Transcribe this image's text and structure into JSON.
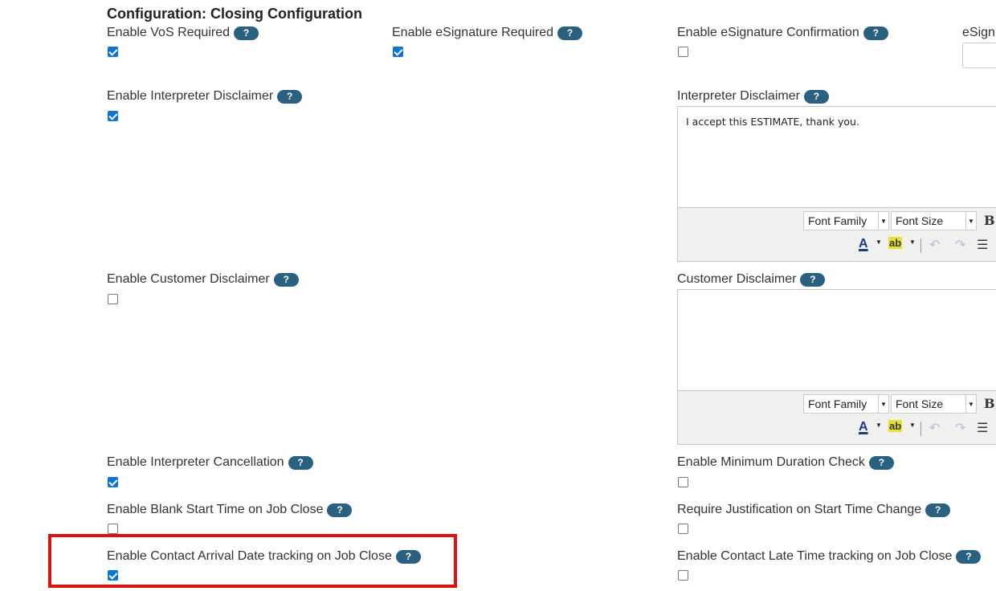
{
  "section_title": "Configuration: Closing Configuration",
  "help_label": "?",
  "fields": {
    "vos_required": {
      "label": "Enable VoS Required",
      "checked": true
    },
    "esignature_required": {
      "label": "Enable eSignature Required",
      "checked": true
    },
    "esignature_confirmation": {
      "label": "Enable eSignature Confirmation",
      "checked": false
    },
    "esign_partial": {
      "label": "eSign"
    },
    "interpreter_disclaimer_enable": {
      "label": "Enable Interpreter Disclaimer",
      "checked": true
    },
    "interpreter_disclaimer": {
      "label": "Interpreter Disclaimer",
      "text": "I accept this ESTIMATE, thank you."
    },
    "customer_disclaimer_enable": {
      "label": "Enable Customer Disclaimer",
      "checked": false
    },
    "customer_disclaimer": {
      "label": "Customer Disclaimer",
      "text": ""
    },
    "interpreter_cancellation": {
      "label": "Enable Interpreter Cancellation",
      "checked": true
    },
    "minimum_duration_check": {
      "label": "Enable Minimum Duration Check",
      "checked": false
    },
    "blank_start_time": {
      "label": "Enable Blank Start Time on Job Close",
      "checked": false
    },
    "justification_start_time": {
      "label": "Require Justification on Start Time Change",
      "checked": false
    },
    "contact_arrival_tracking": {
      "label": "Enable Contact Arrival Date tracking on Job Close",
      "checked": true
    },
    "contact_late_time_tracking": {
      "label": "Enable Contact Late Time tracking on Job Close",
      "checked": false
    }
  },
  "editor_toolbar": {
    "font_family": "Font Family",
    "font_size": "Font Size",
    "bold": "B",
    "font_color_glyph": "A",
    "highlight_glyph": "ab",
    "undo_glyph": "↶",
    "redo_glyph": "↷",
    "list_glyph": "☰",
    "dropdown_arrow": "▼"
  },
  "colors": {
    "help_badge": "#2a6080",
    "checkbox_checked": "#0a75d6",
    "highlight_box": "#dd1111"
  }
}
